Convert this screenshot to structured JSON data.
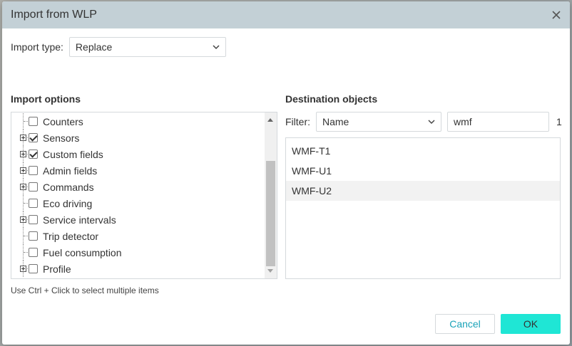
{
  "dialog": {
    "title": "Import from WLP",
    "close_icon": "close-icon"
  },
  "import_type": {
    "label": "Import type:",
    "value": "Replace"
  },
  "import_options": {
    "title": "Import options",
    "items": [
      {
        "label": "Counters",
        "checked": false,
        "expandable": false
      },
      {
        "label": "Sensors",
        "checked": true,
        "expandable": true
      },
      {
        "label": "Custom fields",
        "checked": true,
        "expandable": true
      },
      {
        "label": "Admin fields",
        "checked": false,
        "expandable": true
      },
      {
        "label": "Commands",
        "checked": false,
        "expandable": true
      },
      {
        "label": "Eco driving",
        "checked": false,
        "expandable": false
      },
      {
        "label": "Service intervals",
        "checked": false,
        "expandable": true
      },
      {
        "label": "Trip detector",
        "checked": false,
        "expandable": false
      },
      {
        "label": "Fuel consumption",
        "checked": false,
        "expandable": false
      },
      {
        "label": "Profile",
        "checked": false,
        "expandable": true
      }
    ],
    "hint": "Use Ctrl + Click to select multiple items"
  },
  "destination": {
    "title": "Destination objects",
    "filter_label": "Filter:",
    "filter_field": "Name",
    "filter_value": "wmf",
    "count": "1",
    "objects": [
      "WMF-T1",
      "WMF-U1",
      "WMF-U2"
    ],
    "highlighted_index": 2
  },
  "buttons": {
    "cancel": "Cancel",
    "ok": "OK"
  },
  "colors": {
    "titlebar": "#c3d0d6",
    "ok_button": "#1fe6d5",
    "cancel_text": "#1aa3b8"
  }
}
